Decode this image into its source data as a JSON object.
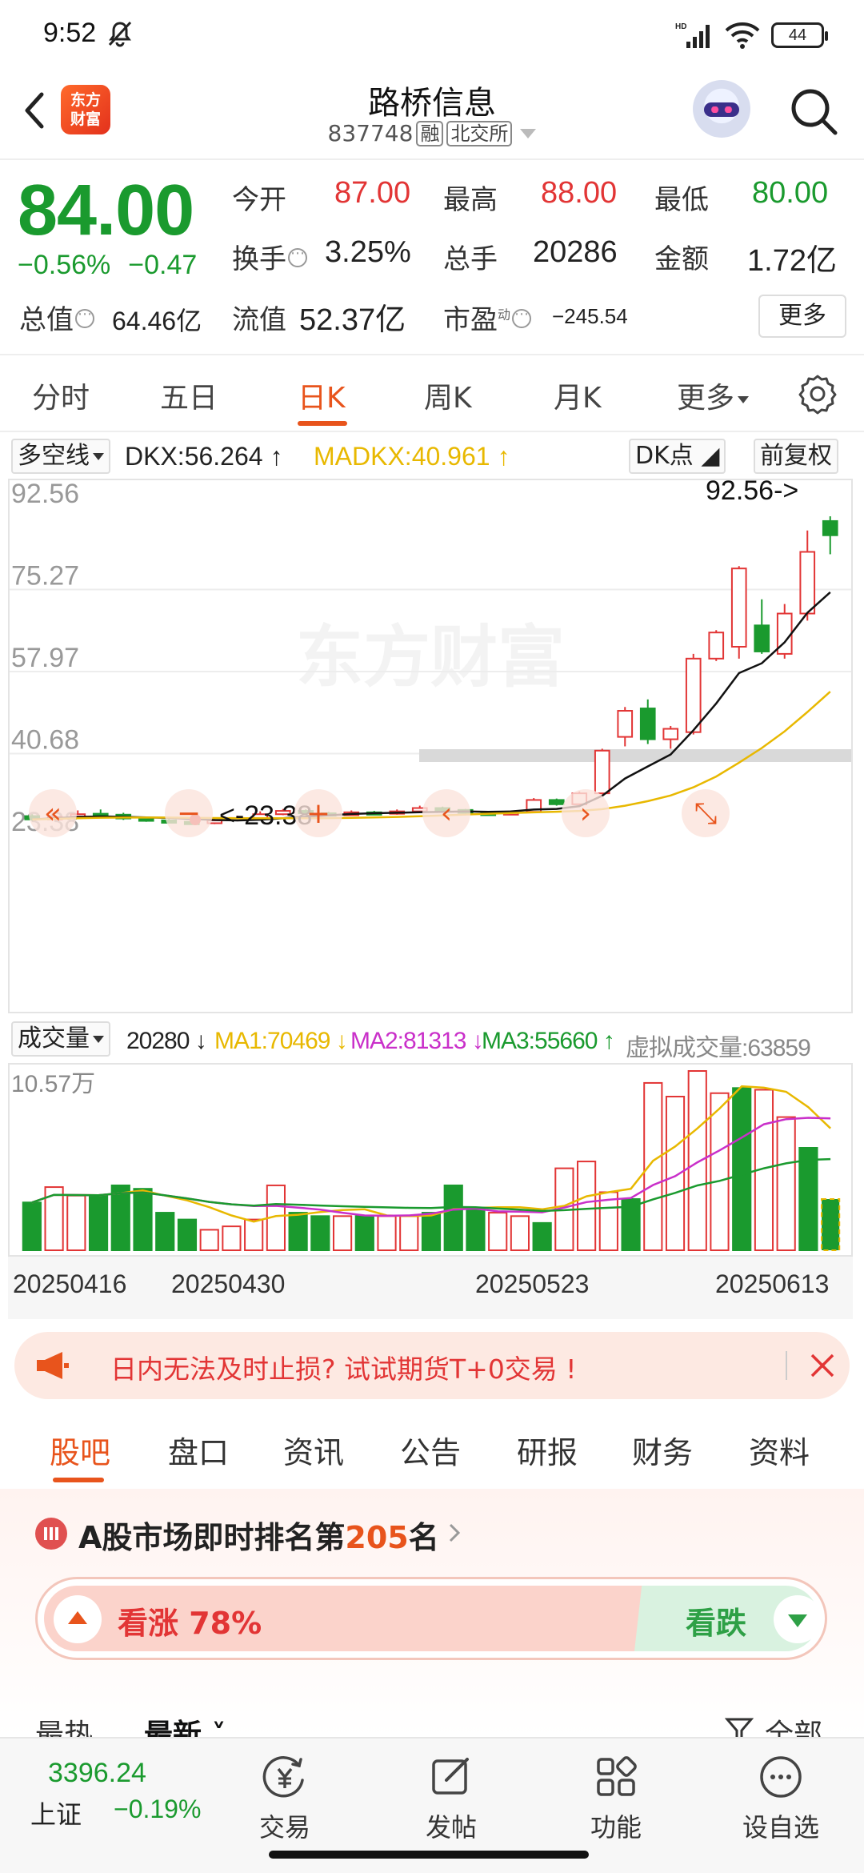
{
  "status_bar": {
    "time": "9:52",
    "battery": "44",
    "net": "HD"
  },
  "header": {
    "logo_line1": "东方",
    "logo_line2": "财富",
    "stock_name": "路桥信息",
    "stock_code": "837748",
    "tag_margin": "融",
    "tag_exchange": "北交所"
  },
  "quote": {
    "price": "84.00",
    "change_pct": "−0.56%",
    "change_amt": "−0.47",
    "open_label": "今开",
    "open": "87.00",
    "high_label": "最高",
    "high": "88.00",
    "low_label": "最低",
    "low": "80.00",
    "turnover_label": "换手",
    "turnover": "3.25%",
    "volume_label": "总手",
    "volume": "20286",
    "amount_label": "金额",
    "amount": "1.72亿",
    "mktcap_label": "总值",
    "mktcap": "64.46亿",
    "float_label": "流值",
    "float_cap": "52.37亿",
    "pe_label": "市盈",
    "pe_sup": "动",
    "pe": "−245.54",
    "more_label": "更多"
  },
  "period_tabs": [
    "分时",
    "五日",
    "日K",
    "周K",
    "月K",
    "更多"
  ],
  "period_active": 2,
  "indicator": {
    "selector": "多空线",
    "dkx": "DKX:56.264",
    "madkx": "MADKX:40.961",
    "dk_point": "DK点",
    "adjust": "前复权"
  },
  "kchart": {
    "y_labels": [
      "92.56",
      "75.27",
      "57.97",
      "40.68",
      "23.38"
    ],
    "max_marker": "92.56->",
    "min_marker": "<-23.38",
    "watermark": "东方财富"
  },
  "volume": {
    "selector": "成交量",
    "vol": "20280",
    "ma1": "MA1:70469",
    "ma2": "MA2:81313",
    "ma3": "MA3:55660",
    "virtual": "虚拟成交量:63859",
    "max_label": "10.57万"
  },
  "dates": [
    "20250416",
    "20250430",
    "20250523",
    "20250613"
  ],
  "ad": {
    "text": "日内无法及时止损? 试试期货T+0交易 !"
  },
  "content_tabs": [
    "股吧",
    "盘口",
    "资讯",
    "公告",
    "研报",
    "财务",
    "资料"
  ],
  "content_active": 0,
  "rank": {
    "prefix": "A股市场即时排名第",
    "number": "205",
    "suffix": "名"
  },
  "vote": {
    "up_label": "看涨 78%",
    "up_pct": 78,
    "down_label": "看跌"
  },
  "feed_sort": [
    "最热",
    "最新",
    "全部"
  ],
  "bottom_nav": {
    "index_value": "3396.24",
    "index_name": "上证",
    "index_change": "−0.19%",
    "items": [
      "交易",
      "发帖",
      "功能",
      "设自选"
    ]
  },
  "colors": {
    "up": "#e23535",
    "down": "#1a9a2e",
    "accent": "#e8541c"
  },
  "chart_data": {
    "type": "candlestick",
    "y_labels": [
      "92.56",
      "75.27",
      "57.97",
      "40.68",
      "23.38"
    ],
    "ylim": [
      23.38,
      92.56
    ],
    "max": 92.56,
    "min": 23.38,
    "candles": [
      {
        "o": 24.8,
        "c": 24.1,
        "h": 25.2,
        "l": 23.8
      },
      {
        "o": 24.2,
        "c": 24.6,
        "h": 25.0,
        "l": 23.9
      },
      {
        "o": 24.7,
        "c": 25.2,
        "h": 26.0,
        "l": 24.4
      },
      {
        "o": 25.3,
        "c": 25.0,
        "h": 26.2,
        "l": 24.8
      },
      {
        "o": 25.1,
        "c": 24.3,
        "h": 25.5,
        "l": 24.0
      },
      {
        "o": 24.3,
        "c": 23.9,
        "h": 24.6,
        "l": 23.6
      },
      {
        "o": 23.9,
        "c": 23.6,
        "h": 24.2,
        "l": 23.4
      },
      {
        "o": 23.6,
        "c": 23.2,
        "h": 24.0,
        "l": 23.38
      },
      {
        "o": 23.3,
        "c": 23.9,
        "h": 24.2,
        "l": 23.1
      },
      {
        "o": 23.9,
        "c": 24.4,
        "h": 24.9,
        "l": 23.7
      },
      {
        "o": 24.4,
        "c": 25.2,
        "h": 25.8,
        "l": 24.2
      },
      {
        "o": 25.2,
        "c": 25.9,
        "h": 26.3,
        "l": 25.0
      },
      {
        "o": 25.9,
        "c": 25.4,
        "h": 26.2,
        "l": 25.2
      },
      {
        "o": 25.4,
        "c": 25.0,
        "h": 25.7,
        "l": 24.8
      },
      {
        "o": 25.0,
        "c": 25.6,
        "h": 26.0,
        "l": 24.9
      },
      {
        "o": 25.6,
        "c": 25.3,
        "h": 25.9,
        "l": 25.1
      },
      {
        "o": 25.3,
        "c": 25.8,
        "h": 26.2,
        "l": 25.1
      },
      {
        "o": 25.8,
        "c": 26.5,
        "h": 27.0,
        "l": 25.6
      },
      {
        "o": 26.5,
        "c": 26.1,
        "h": 26.8,
        "l": 25.8
      },
      {
        "o": 26.1,
        "c": 25.5,
        "h": 26.3,
        "l": 25.3
      },
      {
        "o": 25.5,
        "c": 25.1,
        "h": 25.9,
        "l": 24.9
      },
      {
        "o": 25.1,
        "c": 25.7,
        "h": 26.0,
        "l": 25.0
      },
      {
        "o": 25.7,
        "c": 28.2,
        "h": 28.6,
        "l": 25.6
      },
      {
        "o": 28.2,
        "c": 27.3,
        "h": 28.5,
        "l": 27.0
      },
      {
        "o": 27.3,
        "c": 29.6,
        "h": 30.0,
        "l": 27.1
      },
      {
        "o": 29.6,
        "c": 38.6,
        "h": 39.0,
        "l": 29.4
      },
      {
        "o": 41.5,
        "c": 47.0,
        "h": 47.8,
        "l": 39.5
      },
      {
        "o": 47.5,
        "c": 41.0,
        "h": 49.4,
        "l": 40.0
      },
      {
        "o": 41.0,
        "c": 43.2,
        "h": 43.8,
        "l": 39.0
      },
      {
        "o": 42.5,
        "c": 58.0,
        "h": 59.0,
        "l": 42.0
      },
      {
        "o": 58.0,
        "c": 63.5,
        "h": 64.0,
        "l": 57.5
      },
      {
        "o": 60.5,
        "c": 77.0,
        "h": 77.5,
        "l": 58.0
      },
      {
        "o": 65.0,
        "c": 59.5,
        "h": 70.5,
        "l": 59.0
      },
      {
        "o": 59.0,
        "c": 67.5,
        "h": 69.5,
        "l": 58.0
      },
      {
        "o": 67.5,
        "c": 80.5,
        "h": 85.0,
        "l": 66.0
      },
      {
        "o": 87.0,
        "c": 84.0,
        "h": 88.0,
        "l": 80.0
      }
    ],
    "volumes": [
      28,
      37,
      32,
      32,
      38,
      36,
      22,
      18,
      12,
      14,
      18,
      38,
      22,
      20,
      20,
      20,
      20,
      20,
      22,
      38,
      24,
      22,
      20,
      16,
      48,
      52,
      34,
      30,
      98,
      90,
      105,
      92,
      95,
      94,
      78,
      60,
      30
    ],
    "vol_max": "10.57万",
    "dates": [
      "20250416",
      "20250430",
      "20250523",
      "20250613"
    ]
  }
}
